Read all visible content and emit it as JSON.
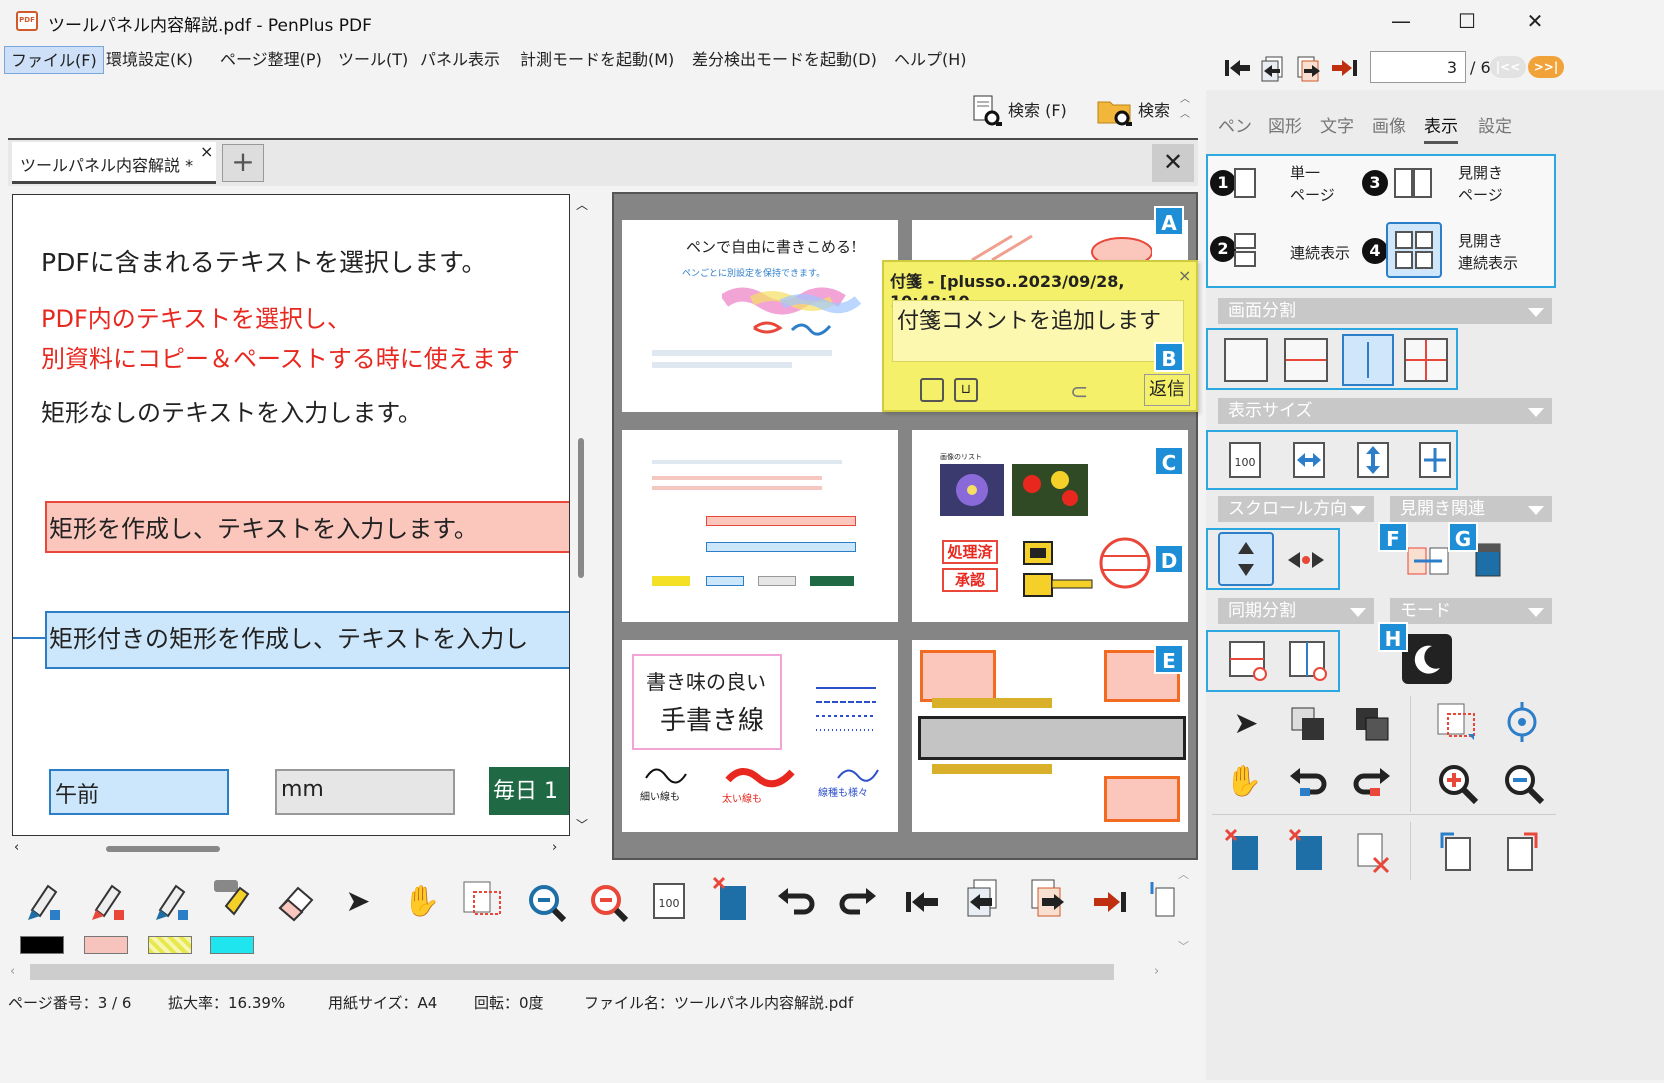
{
  "window": {
    "app_icon_text": "PDF",
    "title": "ツールパネル内容解説.pdf - PenPlus PDF",
    "minimize": "—",
    "maximize": "☐",
    "close": "✕"
  },
  "menu": {
    "file": "ファイル(F)",
    "env": "環境設定(K)",
    "page": "ページ整理(P)",
    "tool": "ツール(T)",
    "panel": "パネル表示",
    "measure": "計測モードを起動(M)",
    "diff": "差分検出モードを起動(D)",
    "help": "ヘルプ(H)"
  },
  "navigation": {
    "current_page": "3",
    "total_pages": "/ 6",
    "prev_pill": "|<<",
    "next_pill": ">>|"
  },
  "search": {
    "search_f": "検索 (F)",
    "search_folder": "検索"
  },
  "doc_tabs": {
    "active": "ツールパネル内容解説 *",
    "close": "×",
    "add": "+",
    "close_doc": "✕"
  },
  "left_page": {
    "line1": "PDFに含まれるテキストを選択します。",
    "line2": "PDF内のテキストを選択し、",
    "line3": "別資料にコピー＆ペーストする時に使えます",
    "line4": "矩形なしのテキストを入力します。",
    "box1": "矩形を作成し、テキストを入力します。",
    "box2": "矩形付きの矩形を作成し、テキストを入力し",
    "field_am": "午前",
    "field_mm": "mm",
    "field_daily": "毎日 1"
  },
  "sticky": {
    "header": "付箋 - [plusso..2023/09/28, 10:48:10",
    "close": "×",
    "body": "付箋コメントを追加します",
    "reply": "返信"
  },
  "thumbs": {
    "t1_title": "ペンで自由に書きこめる!",
    "t1_sub": "ペンごとに別設定を保持できます。",
    "t4_stamp1": "処理済",
    "t4_stamp2": "承認",
    "t4_title": "画像のリスト",
    "t5_line1": "書き味の良い",
    "t5_line2": "手書き線",
    "t5_thin": "細い線も",
    "t5_thick": "太い線も",
    "t5_vary": "線種も様々"
  },
  "right_panel": {
    "tabs": [
      "ペン",
      "図形",
      "文字",
      "画像",
      "表示",
      "設定"
    ],
    "active_tab": "表示",
    "callouts": [
      "A",
      "B",
      "C",
      "D",
      "E",
      "F",
      "G",
      "H"
    ],
    "nums": [
      "1",
      "2",
      "3",
      "4"
    ],
    "single_page": "単一\nページ",
    "single_page_l1": "単一",
    "single_page_l2": "ページ",
    "continuous": "連続表示",
    "spread_l1": "見開き",
    "spread_l2": "ページ",
    "spread_cont_l1": "見開き",
    "spread_cont_l2": "連続表示",
    "sec_split": "画面分割",
    "sec_size": "表示サイズ",
    "sec_scroll": "スクロール方向",
    "sec_spread": "見開き関連",
    "sec_sync": "同期分割",
    "sec_mode": "モード"
  },
  "colors": {
    "swatches": [
      "#000000",
      "#f7c4bd",
      "#e8e84a",
      "#1fe6ee"
    ],
    "accent": "#1e8fd6",
    "sticky": "#f5f06a"
  },
  "status": {
    "page": "ページ番号：3 / 6",
    "zoom": "拡大率：16.39%",
    "paper": "用紙サイズ：A4",
    "rotate": "回転：0度",
    "file": "ファイル名：ツールパネル内容解説.pdf"
  }
}
